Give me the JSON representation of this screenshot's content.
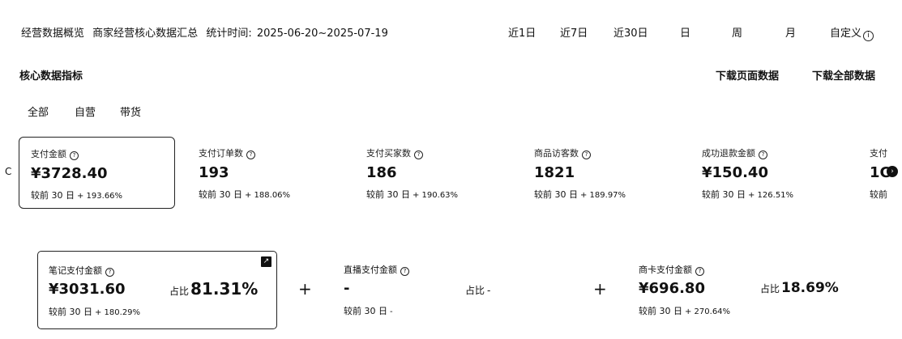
{
  "header": {
    "title": "经营数据概览",
    "subtitle": "商家经营核心数据汇总",
    "period_label": "统计时间:",
    "period_value": "2025-06-20~2025-07-19",
    "ranges": [
      "近1日",
      "近7日",
      "近30日",
      "日",
      "周",
      "月",
      "自定义"
    ],
    "info_glyph": "i"
  },
  "section": {
    "title": "核心数据指标",
    "download_page": "下载页面数据",
    "download_all": "下载全部数据"
  },
  "tabs": [
    "全部",
    "自营",
    "带货"
  ],
  "metrics": [
    {
      "label": "支付金额",
      "value": "¥3728.40",
      "cmp_label": "较前 30 日",
      "cmp_pct": "+ 193.66%"
    },
    {
      "label": "支付订单数",
      "value": "193",
      "cmp_label": "较前 30 日",
      "cmp_pct": "+ 188.06%"
    },
    {
      "label": "支付买家数",
      "value": "186",
      "cmp_label": "较前 30 日",
      "cmp_pct": "+ 190.63%"
    },
    {
      "label": "商品访客数",
      "value": "1821",
      "cmp_label": "较前 30 日",
      "cmp_pct": "+ 189.97%"
    },
    {
      "label": "成功退款金额",
      "value": "¥150.40",
      "cmp_label": "较前 30 日",
      "cmp_pct": "+ 126.51%"
    },
    {
      "label": "支付",
      "value": "1C",
      "cmp_label": "较前",
      "cmp_pct": ""
    }
  ],
  "breakdown": [
    {
      "label": "笔记支付金额",
      "value": "¥3031.60",
      "share_label": "占比",
      "share": "81.31%",
      "cmp_label": "较前 30 日",
      "cmp_pct": "+ 180.29%"
    },
    {
      "label": "直播支付金额",
      "value": "-",
      "share_label": "占比",
      "share": "-",
      "cmp_label": "较前 30 日",
      "cmp_pct": "-"
    },
    {
      "label": "商卡支付金额",
      "value": "¥696.80",
      "share_label": "占比",
      "share": "18.69%",
      "cmp_label": "较前 30 日",
      "cmp_pct": "+ 270.64%"
    }
  ],
  "icons": {
    "question": "?",
    "plus": "+",
    "arrow_left": "C",
    "arrow_right": "›",
    "corner": "↗"
  }
}
